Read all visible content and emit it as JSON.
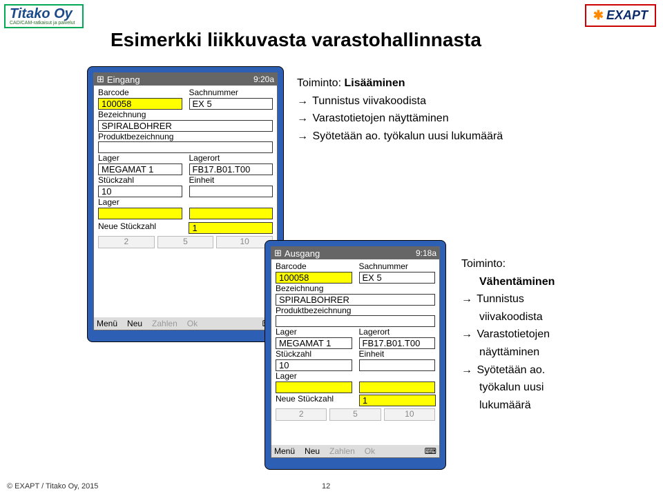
{
  "logoLeft": {
    "company": "Titako Oy",
    "subtitle": "CAD/CAM-ratkaisut ja palvelut"
  },
  "logoRight": {
    "gear": "✱",
    "text": "EXAPT"
  },
  "pageTitle": "Esimerkki liikkuvasta varastohallinnasta",
  "block1": {
    "topicLabel": "Toiminto: ",
    "topicValue": "Lisääminen",
    "line1_arrow": "→",
    "line1": " Tunnistus viivakoodista",
    "line2_arrow": "→",
    "line2": " Varastotietojen näyttäminen",
    "line3_arrow": "→",
    "line3": " Syötetään ao. työkalun uusi lukumäärä"
  },
  "block2": {
    "topicLabel": "Toiminto:",
    "topicValue": "Vähentäminen",
    "line1_arrow": "→",
    "line1": " Tunnistus",
    "line1b": "viivakoodista",
    "line2_arrow": "→",
    "line2": " Varastotietojen",
    "line2b": "näyttäminen",
    "line3_arrow": "→",
    "line3": " Syötetään ao.",
    "line3b": "työkalun uusi",
    "line3c": "lukumäärä"
  },
  "pda1": {
    "winicon": "⊞",
    "title": "Eingang",
    "clock": "9:20a",
    "labels": {
      "barcode": "Barcode",
      "sachnummer": "Sachnummer",
      "bezeichnung": "Bezeichnung",
      "produktbez": "Produktbezeichnung",
      "lager": "Lager",
      "lagerort": "Lagerort",
      "stueckzahl": "Stückzahl",
      "einheit": "Einheit",
      "neue": "Neue Stückzahl"
    },
    "values": {
      "barcode": "100058",
      "sachnummer": "EX 5",
      "bezeichnung": "SPIRALBOHRER",
      "produktbez": "",
      "lager": "MEGAMAT 1",
      "lagerort": "FB17.B01.T00",
      "stueckzahl": "10",
      "einheit": "",
      "lager2": "",
      "neue": "1"
    },
    "nbtns": {
      "n2": "2",
      "n5": "5",
      "n10": "10"
    },
    "menu": {
      "menu": "Menü",
      "neu": "Neu",
      "zahlen": "Zahlen",
      "ok": "Ok",
      "kb": "⌨"
    }
  },
  "pda2": {
    "winicon": "⊞",
    "title": "Ausgang",
    "clock": "9:18a",
    "labels": {
      "barcode": "Barcode",
      "sachnummer": "Sachnummer",
      "bezeichnung": "Bezeichnung",
      "produktbez": "Produktbezeichnung",
      "lager": "Lager",
      "lagerort": "Lagerort",
      "stueckzahl": "Stückzahl",
      "einheit": "Einheit",
      "neue": "Neue Stückzahl"
    },
    "values": {
      "barcode": "100058",
      "sachnummer": "EX 5",
      "bezeichnung": "SPIRALBOHRER",
      "produktbez": "",
      "lager": "MEGAMAT 1",
      "lagerort": "FB17.B01.T00",
      "stueckzahl": "10",
      "einheit": "",
      "lager2": "",
      "neue": "1"
    },
    "nbtns": {
      "n2": "2",
      "n5": "5",
      "n10": "10"
    },
    "menu": {
      "menu": "Menü",
      "neu": "Neu",
      "zahlen": "Zahlen",
      "ok": "Ok",
      "kb": "⌨"
    }
  },
  "footer": "© EXAPT / Titako Oy, 2015",
  "pagenum": "12"
}
